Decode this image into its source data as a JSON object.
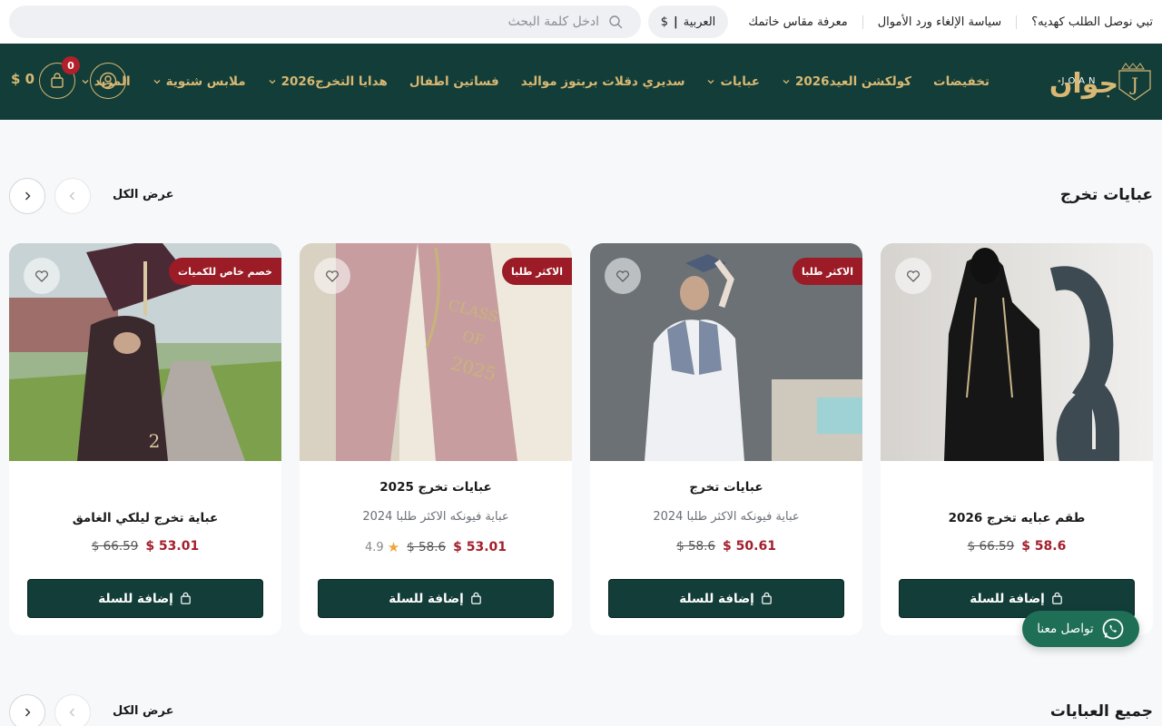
{
  "topbar": {
    "links": [
      "تبي نوصل الطلب كهديه؟",
      "سياسة الإلغاء ورد الأموال",
      "معرفة مقاس خاتمك"
    ],
    "language": "العربية",
    "currency": "$",
    "search_placeholder": "ادخل كلمة البحث"
  },
  "brand": {
    "arabic": "جوان",
    "latin": "JOAN",
    "initial": "J"
  },
  "nav": {
    "items": [
      {
        "label": "تخفيضات",
        "dropdown": false
      },
      {
        "label": "كولكشن العيد2026",
        "dropdown": true
      },
      {
        "label": "عبايات",
        "dropdown": true
      },
      {
        "label": "سديري دقلات بربتوز مواليد",
        "dropdown": false
      },
      {
        "label": "فساتين اطفال",
        "dropdown": false
      },
      {
        "label": "هدايا التخرج2026",
        "dropdown": true
      },
      {
        "label": "ملابس شتوية",
        "dropdown": true
      },
      {
        "label": "المزيد",
        "dropdown": true
      }
    ],
    "cart_count": "0",
    "cart_total": "$ 0"
  },
  "sections": [
    {
      "title": "عبايات تخرج",
      "view_all": "عرض الكل"
    },
    {
      "title": "جميع العبايات",
      "view_all": "عرض الكل"
    }
  ],
  "products": [
    {
      "name": "طقم عبايه تخرج 2026",
      "subtitle": "",
      "price": "$ 58.6",
      "old_price": "$ 66.59",
      "badge": "",
      "rating": "",
      "add_label": "إضافة للسلة"
    },
    {
      "name": "عبايات تخرج",
      "subtitle": "عباية فيونكه الاكثر طلبا 2024",
      "price": "$ 50.61",
      "old_price": "$ 58.6",
      "badge": "الاكثر طلبا",
      "rating": "",
      "add_label": "إضافة للسلة"
    },
    {
      "name": "عبايات تخرج 2025",
      "subtitle": "عباية فيونكه الاكثر طلبا 2024",
      "price": "$ 53.01",
      "old_price": "$ 58.6",
      "badge": "الاكثر طلبا",
      "rating": "4.9",
      "add_label": "إضافة للسلة"
    },
    {
      "name": "عباية تخرج ليلكي الغامق",
      "subtitle": "",
      "price": "$ 53.01",
      "old_price": "$ 66.59",
      "badge": "خصم خاص للكميات",
      "rating": "",
      "add_label": "إضافة للسلة"
    }
  ],
  "whatsapp_label": "تواصل معنا",
  "colors": {
    "primary": "#123d38",
    "gold": "#d8b873",
    "sale": "#a31f2b",
    "badge": "#9b1b26"
  }
}
